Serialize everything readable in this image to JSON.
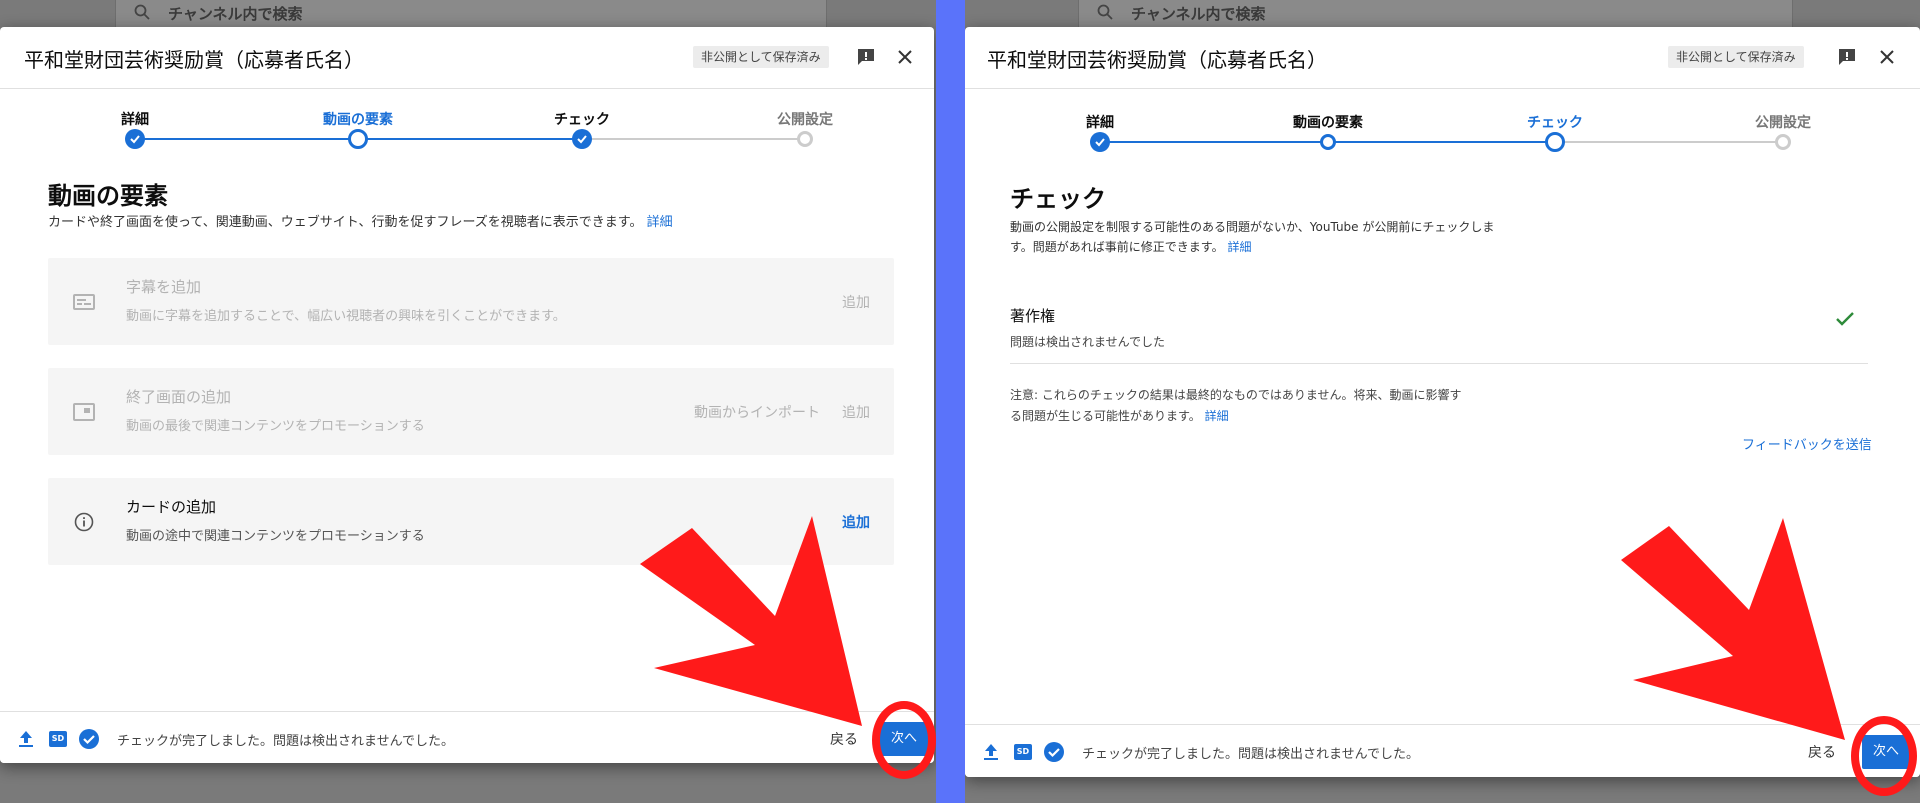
{
  "background": {
    "search_placeholder": "チャンネル内で検索"
  },
  "dialog": {
    "title": "平和堂財団芸術奨励賞（応募者氏名）",
    "saved_badge": "非公開として保存済み"
  },
  "steps": [
    "詳細",
    "動画の要素",
    "チェック",
    "公開設定"
  ],
  "left": {
    "section_title": "動画の要素",
    "section_desc": "カードや終了画面を使って、関連動画、ウェブサイト、行動を促すフレーズを視聴者に表示できます。",
    "learn_more": "詳細",
    "cards": [
      {
        "title": "字幕を追加",
        "desc": "動画に字幕を追加することで、幅広い視聴者の興味を引くことができます。",
        "action": "追加"
      },
      {
        "title": "終了画面の追加",
        "desc": "動画の最後で関連コンテンツをプロモーションする",
        "import_action": "動画からインポート",
        "action": "追加"
      },
      {
        "title": "カードの追加",
        "desc": "動画の途中で関連コンテンツをプロモーションする",
        "action": "追加"
      }
    ]
  },
  "right": {
    "section_title": "チェック",
    "section_desc_line1": "動画の公開設定を制限する可能性のある問題がないか、YouTube が公開前にチェックしま",
    "section_desc_line2": "す。問題があれば事前に修正できます。",
    "learn_more": "詳細",
    "copyright_title": "著作権",
    "copyright_status": "問題は検出されませんでした",
    "note_line1": "注意: これらのチェックの結果は最終的なものではありません。将来、動画に影響す",
    "note_line2": "る問題が生じる可能性があります。",
    "note_learn_more": "詳細",
    "send_feedback": "フィードバックを送信"
  },
  "footer": {
    "sd_label": "SD",
    "status": "チェックが完了しました。問題は検出されませんでした。",
    "back": "戻る",
    "next": "次へ"
  },
  "colors": {
    "accent": "#1a6fd6",
    "annotation": "#ff1a1a",
    "divider": "#5a73fa"
  }
}
